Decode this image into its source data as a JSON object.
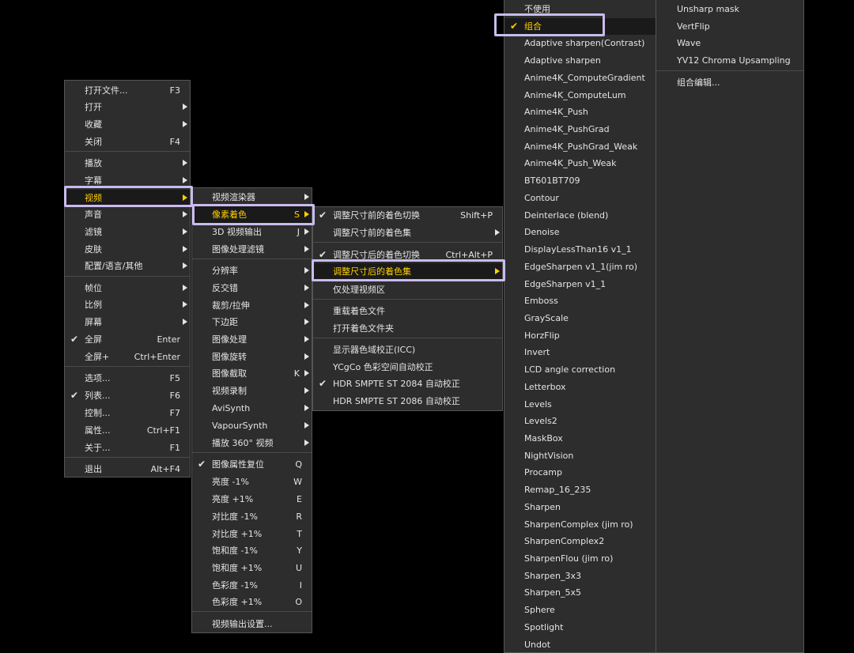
{
  "colors": {
    "menu_bg": "#2d2d2d",
    "text": "#e4e4e4",
    "highlight_text": "#ffd000",
    "highlight_bg": "#1a1a1a",
    "focus_box": "#c9bbef",
    "separator": "#4a4a4a"
  },
  "main_menu": {
    "items": [
      {
        "label": "打开文件...",
        "shortcut": "F3"
      },
      {
        "label": "打开",
        "submenu": true
      },
      {
        "label": "收藏",
        "submenu": true
      },
      {
        "label": "关闭",
        "shortcut": "F4"
      },
      {
        "label": "播放",
        "submenu": true
      },
      {
        "label": "字幕",
        "submenu": true
      },
      {
        "label": "视频",
        "submenu": true,
        "highlighted": true
      },
      {
        "label": "声音",
        "submenu": true
      },
      {
        "label": "滤镜",
        "submenu": true
      },
      {
        "label": "皮肤",
        "submenu": true
      },
      {
        "label": "配置/语言/其他",
        "submenu": true
      },
      {
        "label": "帧位",
        "submenu": true
      },
      {
        "label": "比例",
        "submenu": true
      },
      {
        "label": "屏幕",
        "submenu": true
      },
      {
        "label": "全屏",
        "shortcut": "Enter",
        "checked": true
      },
      {
        "label": "全屏+",
        "shortcut": "Ctrl+Enter"
      },
      {
        "label": "选项...",
        "shortcut": "F5"
      },
      {
        "label": "列表...",
        "shortcut": "F6",
        "checked": true
      },
      {
        "label": "控制...",
        "shortcut": "F7"
      },
      {
        "label": "属性...",
        "shortcut": "Ctrl+F1"
      },
      {
        "label": "关于...",
        "shortcut": "F1"
      },
      {
        "label": "退出",
        "shortcut": "Alt+F4"
      }
    ]
  },
  "video_menu": {
    "items": [
      {
        "label": "视频渲染器",
        "submenu": true
      },
      {
        "label": "像素着色",
        "shortcut": "S",
        "submenu": true,
        "highlighted": true
      },
      {
        "label": "3D 视频输出",
        "shortcut": "J",
        "submenu": true
      },
      {
        "label": "图像处理滤镜",
        "submenu": true
      },
      {
        "label": "分辨率",
        "submenu": true
      },
      {
        "label": "反交错",
        "submenu": true
      },
      {
        "label": "裁剪/拉伸",
        "submenu": true
      },
      {
        "label": "下边距",
        "submenu": true
      },
      {
        "label": "图像处理",
        "submenu": true
      },
      {
        "label": "图像旋转",
        "submenu": true
      },
      {
        "label": "图像截取",
        "shortcut": "K",
        "submenu": true
      },
      {
        "label": "视频录制",
        "submenu": true
      },
      {
        "label": "AviSynth",
        "submenu": true
      },
      {
        "label": "VapourSynth",
        "submenu": true
      },
      {
        "label": "播放 360° 视频",
        "submenu": true
      },
      {
        "label": "图像属性复位",
        "shortcut": "Q",
        "checked": true
      },
      {
        "label": "亮度 -1%",
        "shortcut": "W"
      },
      {
        "label": "亮度 +1%",
        "shortcut": "E"
      },
      {
        "label": "对比度 -1%",
        "shortcut": "R"
      },
      {
        "label": "对比度 +1%",
        "shortcut": "T"
      },
      {
        "label": "饱和度 -1%",
        "shortcut": "Y"
      },
      {
        "label": "饱和度 +1%",
        "shortcut": "U"
      },
      {
        "label": "色彩度 -1%",
        "shortcut": "I"
      },
      {
        "label": "色彩度 +1%",
        "shortcut": "O"
      },
      {
        "label": "视频输出设置..."
      }
    ]
  },
  "shader_menu": {
    "items": [
      {
        "label": "调整尺寸前的着色切换",
        "shortcut": "Shift+P",
        "checked": true
      },
      {
        "label": "调整尺寸前的着色集",
        "submenu": true
      },
      {
        "label": "调整尺寸后的着色切换",
        "shortcut": "Ctrl+Alt+P",
        "checked": true
      },
      {
        "label": "调整尺寸后的着色集",
        "submenu": true,
        "highlighted": true
      },
      {
        "label": "仅处理视频区"
      },
      {
        "label": "重载着色文件"
      },
      {
        "label": "打开着色文件夹"
      },
      {
        "label": "显示器色域校正(ICC)"
      },
      {
        "label": "YCgCo 色彩空间自动校正"
      },
      {
        "label": "HDR SMPTE ST 2084 自动校正",
        "checked": true
      },
      {
        "label": "HDR SMPTE ST 2086 自动校正"
      }
    ]
  },
  "shader_list": {
    "items": [
      {
        "label": "不使用"
      },
      {
        "label": "组合",
        "checked": true,
        "highlighted": true
      },
      {
        "label": "Adaptive sharpen(Contrast)"
      },
      {
        "label": "Adaptive sharpen"
      },
      {
        "label": "Anime4K_ComputeGradient"
      },
      {
        "label": "Anime4K_ComputeLum"
      },
      {
        "label": "Anime4K_Push"
      },
      {
        "label": "Anime4K_PushGrad"
      },
      {
        "label": "Anime4K_PushGrad_Weak"
      },
      {
        "label": "Anime4K_Push_Weak"
      },
      {
        "label": "BT601BT709"
      },
      {
        "label": "Contour"
      },
      {
        "label": "Deinterlace (blend)"
      },
      {
        "label": "Denoise"
      },
      {
        "label": "DisplayLessThan16 v1_1"
      },
      {
        "label": "EdgeSharpen v1_1(jim ro)"
      },
      {
        "label": "EdgeSharpen v1_1"
      },
      {
        "label": "Emboss"
      },
      {
        "label": "GrayScale"
      },
      {
        "label": "HorzFlip"
      },
      {
        "label": "Invert"
      },
      {
        "label": "LCD angle correction"
      },
      {
        "label": "Letterbox"
      },
      {
        "label": "Levels"
      },
      {
        "label": "Levels2"
      },
      {
        "label": "MaskBox"
      },
      {
        "label": "NightVision"
      },
      {
        "label": "Procamp"
      },
      {
        "label": "Remap_16_235"
      },
      {
        "label": "Sharpen"
      },
      {
        "label": "SharpenComplex (jim ro)"
      },
      {
        "label": "SharpenComplex2"
      },
      {
        "label": "SharpenFlou (jim ro)"
      },
      {
        "label": "Sharpen_3x3"
      },
      {
        "label": "Sharpen_5x5"
      },
      {
        "label": "Sphere"
      },
      {
        "label": "Spotlight"
      },
      {
        "label": "Undot"
      }
    ]
  },
  "shader_list_extra": {
    "items": [
      {
        "label": "Unsharp mask"
      },
      {
        "label": "VertFlip"
      },
      {
        "label": "Wave"
      },
      {
        "label": "YV12 Chroma Upsampling"
      },
      {
        "label": "组合编辑..."
      }
    ]
  }
}
